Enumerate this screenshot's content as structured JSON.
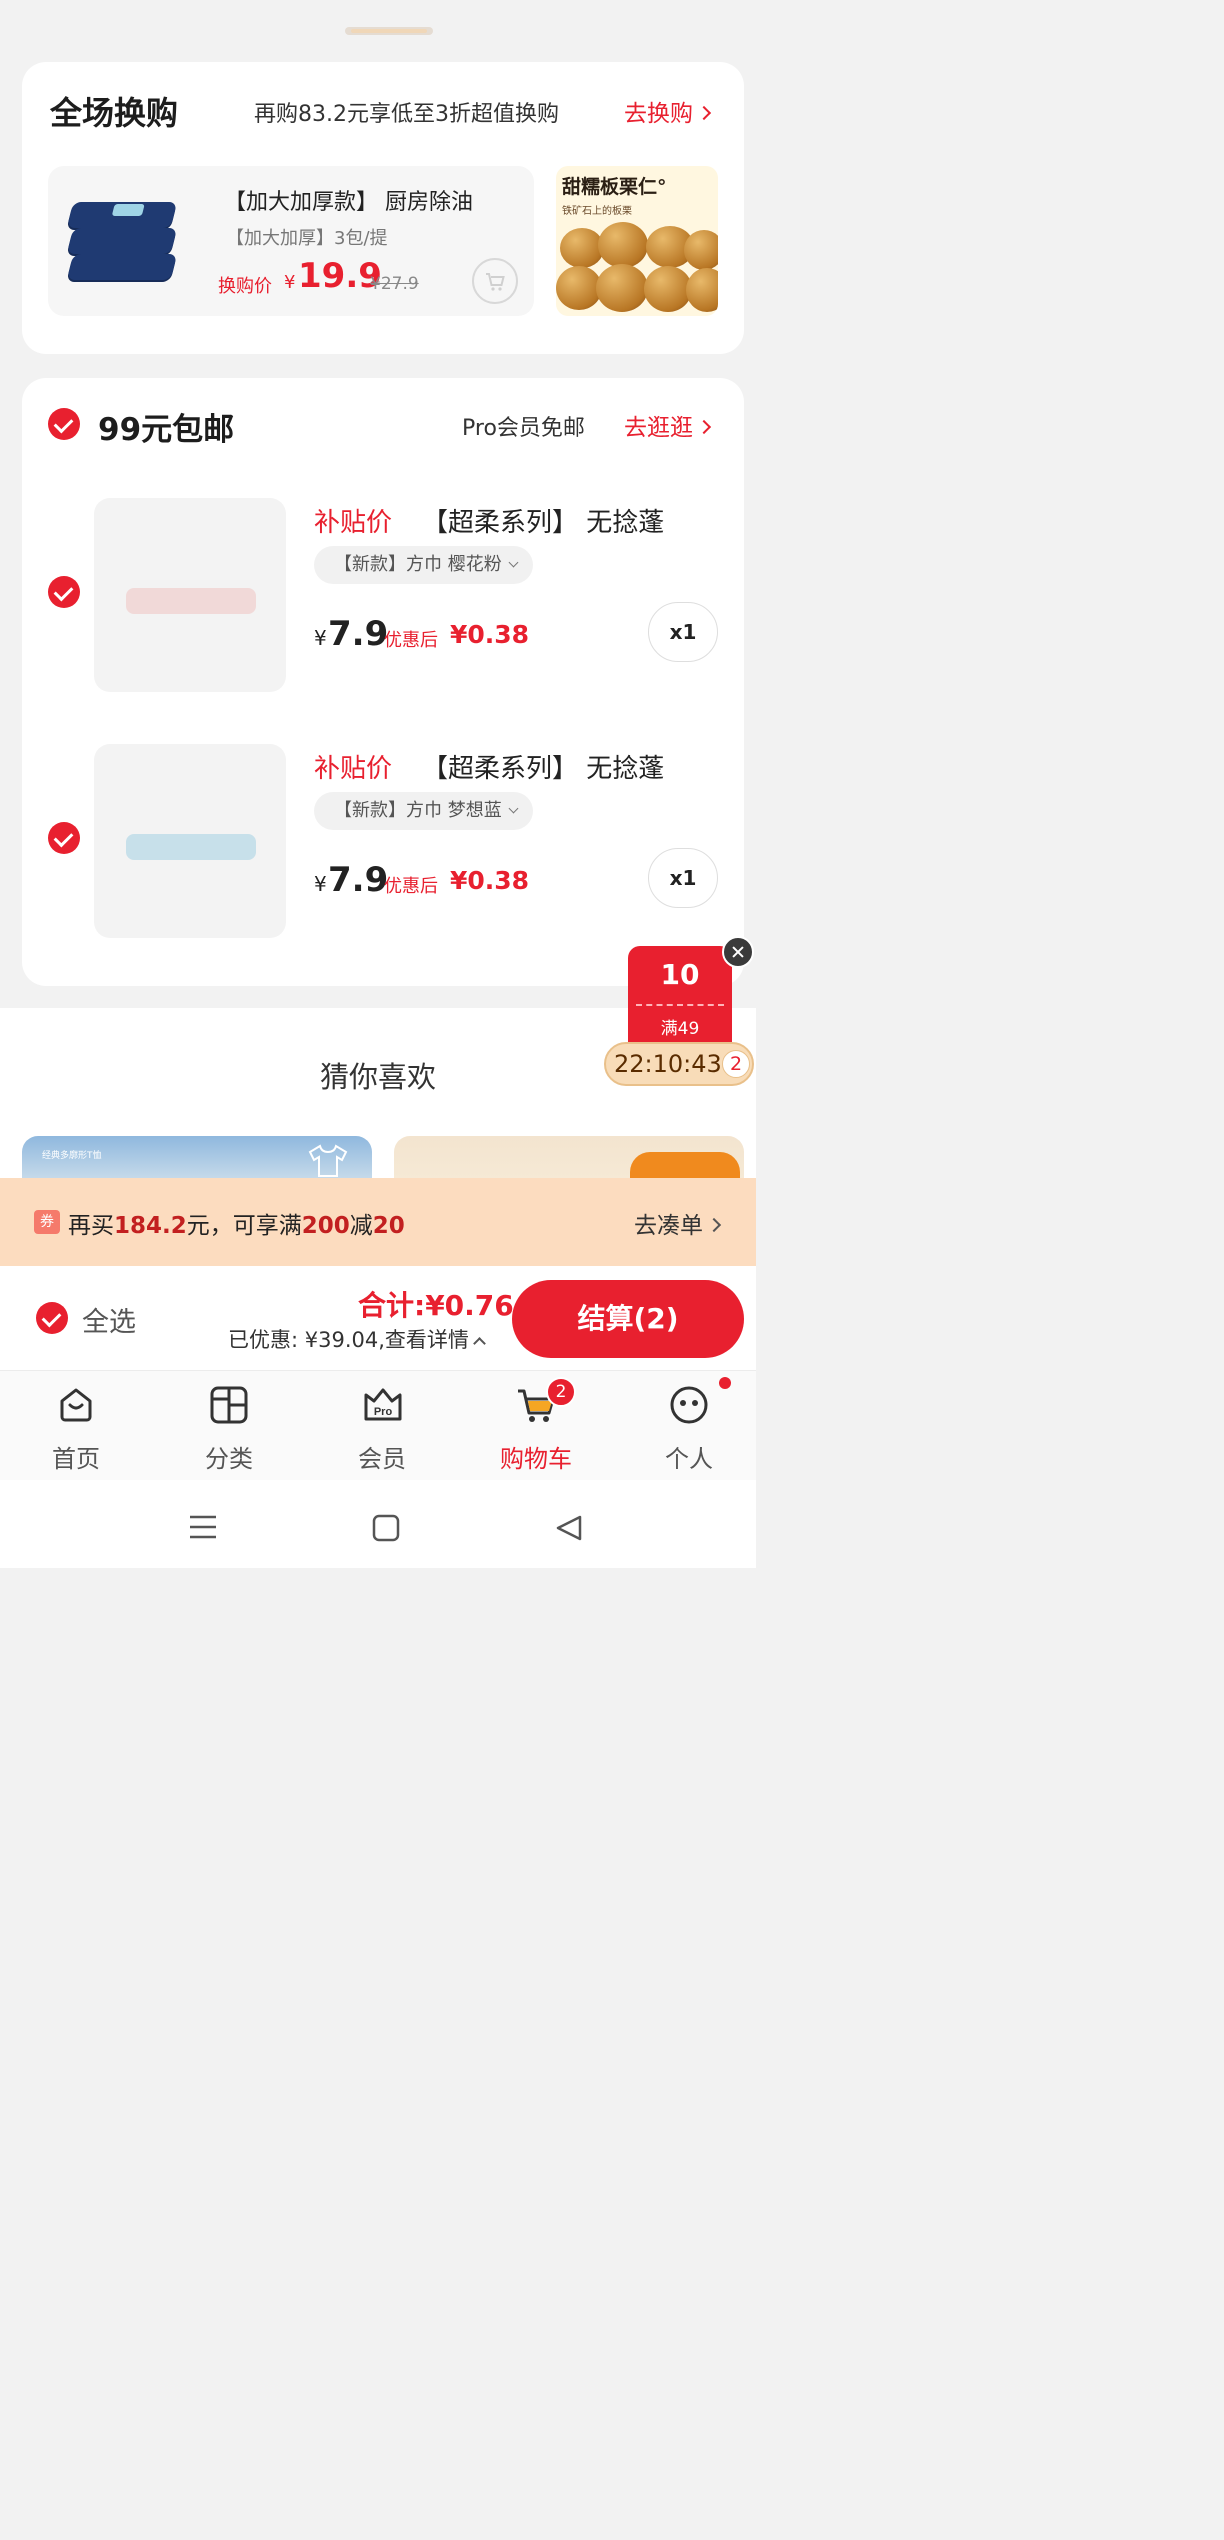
{
  "swap": {
    "title": "全场换购",
    "desc": "再购83.2元享低至3折超值换购",
    "link": "去换购",
    "item": {
      "name": "【加大加厚款】 厨房除油",
      "spec": "【加大加厚】3包/提",
      "price_label": "换购价",
      "currency": "¥",
      "price": "19.9",
      "old_price": "¥27.9"
    },
    "item2": {
      "title": "甜糯板栗仁°",
      "subtitle": "铁矿石上的板栗"
    }
  },
  "shipping": {
    "title": "99元包邮",
    "desc": "Pro会员免邮",
    "link": "去逛逛"
  },
  "products": [
    {
      "tag": "补贴价",
      "name": "【超柔系列】 无捻蓬",
      "spec": "【新款】方巾 樱花粉",
      "currency": "¥",
      "price": "7.9",
      "after_label": "优惠后",
      "after_price": "¥0.38",
      "qty": "x1",
      "color": "#f1d9d8"
    },
    {
      "tag": "补贴价",
      "name": "【超柔系列】 无捻蓬",
      "spec": "【新款】方巾 梦想蓝",
      "currency": "¥",
      "price": "7.9",
      "after_label": "优惠后",
      "after_price": "¥0.38",
      "qty": "x1",
      "color": "#c7e0ea"
    }
  ],
  "guess": {
    "title": "猜你喜欢",
    "rec1_text": "经典多廓形T恤"
  },
  "coupon": {
    "amount": "10",
    "condition": "满49",
    "timer": "22:10:43",
    "count": "2"
  },
  "promo": {
    "icon": "券",
    "text_a": "再买",
    "amount": "184.2",
    "text_b": "元，可享满",
    "threshold": "200",
    "text_c": "减",
    "discount": "20",
    "link": "去凑单"
  },
  "checkout": {
    "select_all": "全选",
    "total": "合计:¥0.76",
    "saved": "已优惠: ¥39.04,查看详情",
    "pay": "结算(2)"
  },
  "tabs": [
    {
      "label": "首页",
      "icon": "home-icon"
    },
    {
      "label": "分类",
      "icon": "category-icon"
    },
    {
      "label": "会员",
      "icon": "pro-member-icon"
    },
    {
      "label": "购物车",
      "icon": "cart-icon",
      "badge": "2"
    },
    {
      "label": "个人",
      "icon": "profile-icon"
    }
  ],
  "accent": "#e8202f"
}
